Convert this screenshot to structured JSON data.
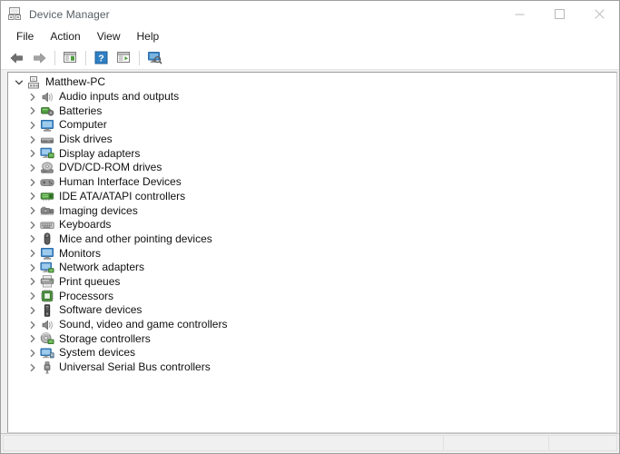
{
  "window": {
    "title": "Device Manager",
    "icon": "device-manager-icon",
    "controls": {
      "minimize": "minimize-icon",
      "maximize": "maximize-icon",
      "close": "close-icon"
    }
  },
  "menubar": {
    "items": [
      {
        "label": "File"
      },
      {
        "label": "Action"
      },
      {
        "label": "View"
      },
      {
        "label": "Help"
      }
    ]
  },
  "toolbar": {
    "buttons": [
      {
        "name": "back-arrow-icon",
        "enabled": true
      },
      {
        "name": "forward-arrow-icon",
        "enabled": true
      },
      {
        "name": "separator-1"
      },
      {
        "name": "show-console-tree-icon",
        "enabled": true
      },
      {
        "name": "separator-2"
      },
      {
        "name": "help-icon",
        "enabled": true
      },
      {
        "name": "properties-icon",
        "enabled": true
      },
      {
        "name": "separator-3"
      },
      {
        "name": "scan-for-hardware-changes-icon",
        "enabled": true
      }
    ]
  },
  "tree": {
    "root": {
      "label": "Matthew-PC",
      "icon": "computer-root-icon",
      "expanded": true,
      "twisty": "chevron-down-icon"
    },
    "nodes": [
      {
        "label": "Audio inputs and outputs",
        "icon": "speaker-icon"
      },
      {
        "label": "Batteries",
        "icon": "battery-icon"
      },
      {
        "label": "Computer",
        "icon": "monitor-icon"
      },
      {
        "label": "Disk drives",
        "icon": "disk-drive-icon"
      },
      {
        "label": "Display adapters",
        "icon": "display-adapter-icon"
      },
      {
        "label": "DVD/CD-ROM drives",
        "icon": "optical-drive-icon"
      },
      {
        "label": "Human Interface Devices",
        "icon": "gamepad-icon"
      },
      {
        "label": "IDE ATA/ATAPI controllers",
        "icon": "ide-controller-icon"
      },
      {
        "label": "Imaging devices",
        "icon": "camera-icon"
      },
      {
        "label": "Keyboards",
        "icon": "keyboard-icon"
      },
      {
        "label": "Mice and other pointing devices",
        "icon": "mouse-icon"
      },
      {
        "label": "Monitors",
        "icon": "monitor-icon"
      },
      {
        "label": "Network adapters",
        "icon": "network-adapter-icon"
      },
      {
        "label": "Print queues",
        "icon": "printer-icon"
      },
      {
        "label": "Processors",
        "icon": "processor-icon"
      },
      {
        "label": "Software devices",
        "icon": "software-device-icon"
      },
      {
        "label": "Sound, video and game controllers",
        "icon": "speaker-icon"
      },
      {
        "label": "Storage controllers",
        "icon": "storage-controller-icon"
      },
      {
        "label": "System devices",
        "icon": "system-device-icon"
      },
      {
        "label": "Universal Serial Bus controllers",
        "icon": "usb-icon"
      }
    ],
    "child_twisty": "chevron-right-icon"
  },
  "statusbar": {
    "panels": [
      {
        "name": "status-message",
        "text": ""
      },
      {
        "name": "status-secondary",
        "text": ""
      },
      {
        "name": "status-tertiary",
        "text": ""
      }
    ]
  },
  "colors": {
    "title_text": "#555d63",
    "tree_text": "#111111",
    "window_bg": "#f0f0f0",
    "pane_bg": "#ffffff",
    "accent_blue": "#2f7fc4",
    "accent_green": "#4f9c3f"
  }
}
